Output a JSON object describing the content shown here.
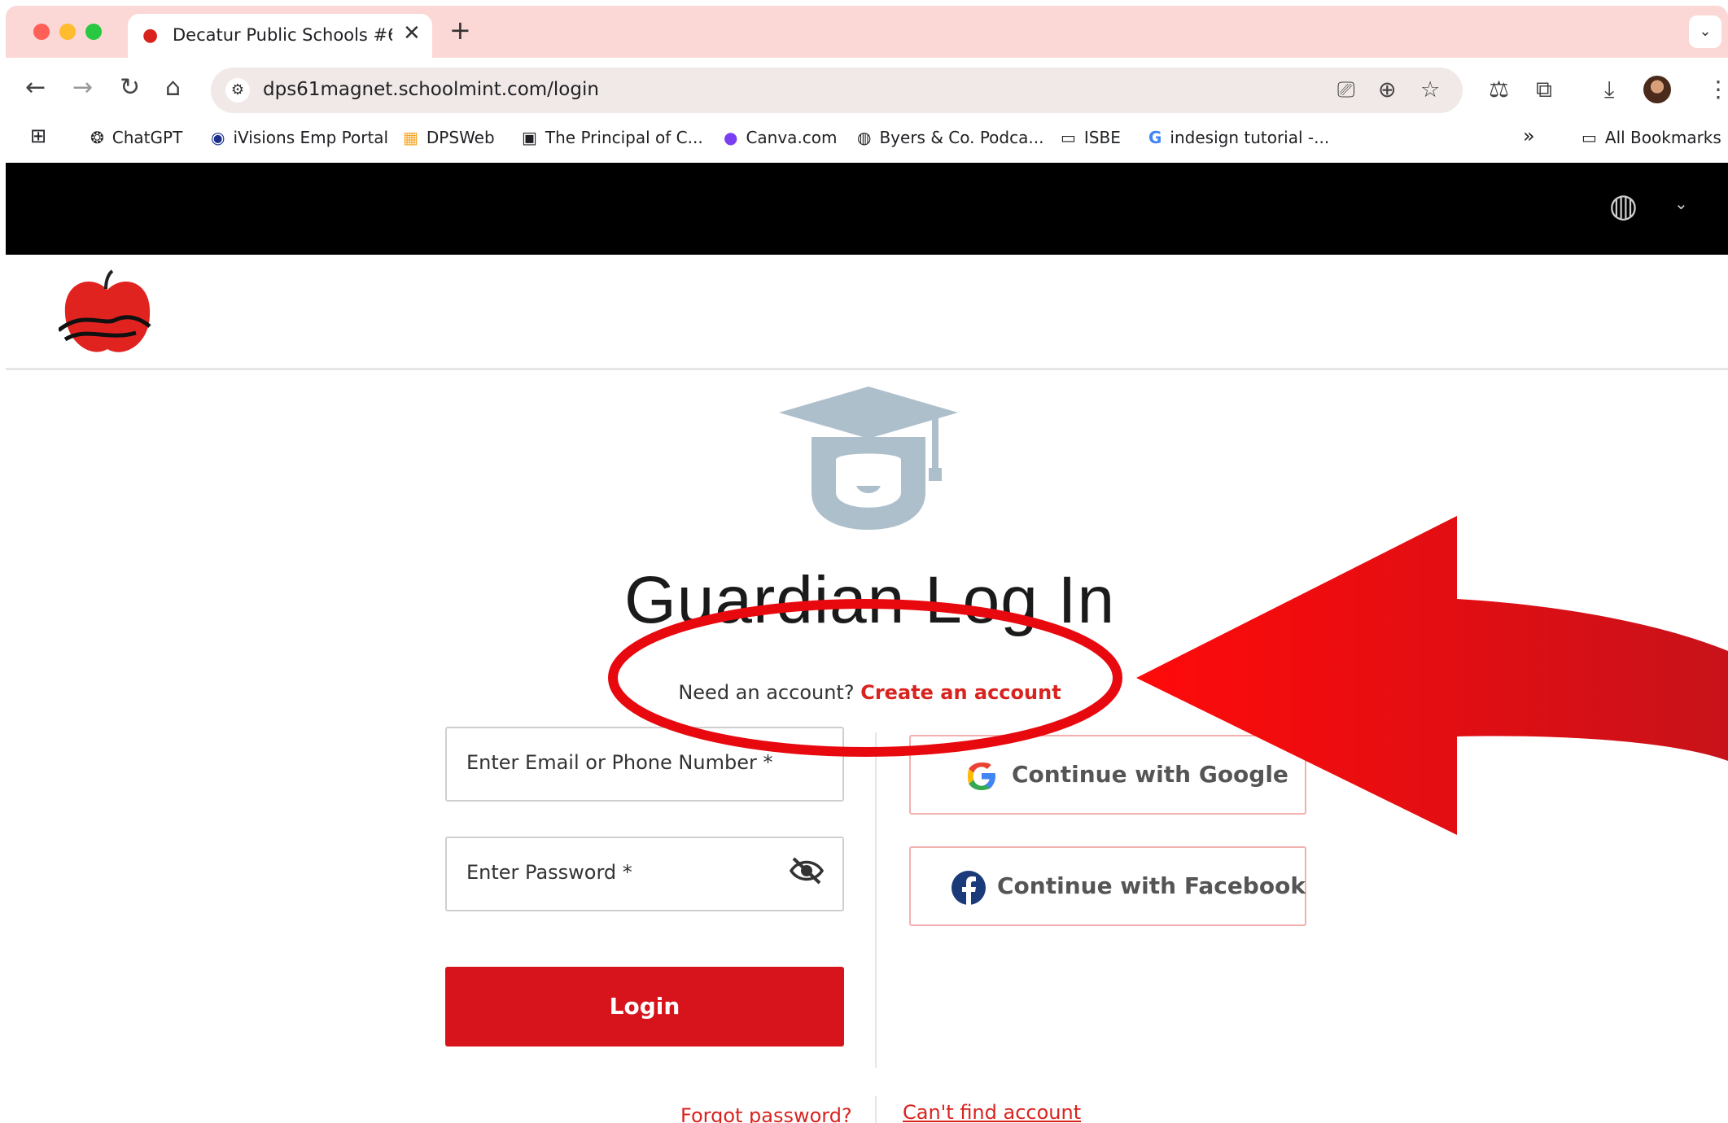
{
  "browser": {
    "tab_title": "Decatur Public Schools #61 |",
    "tab_close": "✕",
    "new_tab": "+",
    "url": "dps61magnet.schoolmint.com/login",
    "bookmarks": [
      {
        "label": "ChatGPT",
        "icon": "chatgpt-icon"
      },
      {
        "label": "iVisions Emp Portal",
        "icon": "ivisions-icon"
      },
      {
        "label": "DPSWeb",
        "icon": "dpsweb-icon"
      },
      {
        "label": "The Principal of C...",
        "icon": "principal-icon"
      },
      {
        "label": "Canva.com",
        "icon": "canva-icon"
      },
      {
        "label": "Byers & Co. Podca...",
        "icon": "globe-icon"
      },
      {
        "label": "ISBE",
        "icon": "folder-icon"
      },
      {
        "label": "indesign tutorial -...",
        "icon": "google-icon"
      }
    ],
    "more_bookmarks": "»",
    "all_bookmarks": "All Bookmarks"
  },
  "page": {
    "title": "Guardian Log In",
    "need_account": "Need an account?",
    "create_account": "Create an account",
    "email_placeholder": "Enter Email or Phone Number *",
    "password_placeholder": "Enter Password *",
    "login_label": "Login",
    "google_label": "Continue with Google",
    "facebook_label": "Continue with Facebook",
    "forgot_password": "Forgot password?",
    "cant_find": "Can't find account"
  },
  "colors": {
    "brand_red": "#d7141b",
    "annotation_red": "#e8090f",
    "tab_strip": "#fbd8d5",
    "cap_blue": "#aebfcc"
  }
}
